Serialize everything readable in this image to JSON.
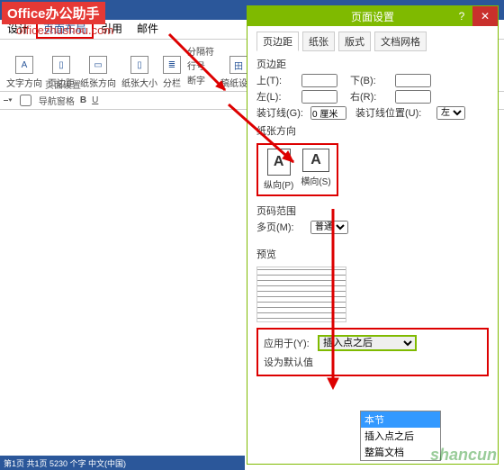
{
  "badge": "Office办公助手",
  "url": "officezhushou.com",
  "word": {
    "icon": "W"
  },
  "tabs": {
    "design": "设计",
    "layout": "页面布局",
    "ref": "引用",
    "mail": "邮件"
  },
  "ribbon": {
    "text_dir": "文字方向",
    "margins": "页边距",
    "orient": "纸张方向",
    "size": "纸张大小",
    "columns": "分栏",
    "breaks": "分隔符",
    "line_num": "行号",
    "hyph": "断字",
    "manuscript_setting": "稿纸设置",
    "manuscript": "稿纸",
    "group": "页面设置"
  },
  "qat": {
    "nav": "导航窗格",
    "b": "B",
    "u": "U"
  },
  "dialog": {
    "title": "页面设置",
    "tab_margins": "页边距",
    "tab_paper": "纸张",
    "tab_layout": "版式",
    "tab_grid": "文档网格",
    "sec_margins": "页边距",
    "top": "上(T):",
    "bottom": "下(B):",
    "left": "左(L):",
    "right": "右(R):",
    "gutter": "装订线(G):",
    "gutter_val": "0 厘米",
    "gutter_pos": "装订线位置(U):",
    "gutter_pos_val": "左",
    "sec_orient": "纸张方向",
    "portrait": "纵向(P)",
    "landscape": "横向(S)",
    "glyph": "A",
    "sec_range": "页码范围",
    "multi": "多页(M):",
    "multi_val": "普通",
    "sec_preview": "预览",
    "apply_to": "应用于(Y):",
    "apply_val": "插入点之后",
    "opt_this": "本节",
    "opt_after": "插入点之后",
    "opt_whole": "整篇文档",
    "set_default": "设为默认值"
  },
  "statusbar": "第1页  共1页   5230 个字   中文(中国)",
  "watermark": "shancun"
}
